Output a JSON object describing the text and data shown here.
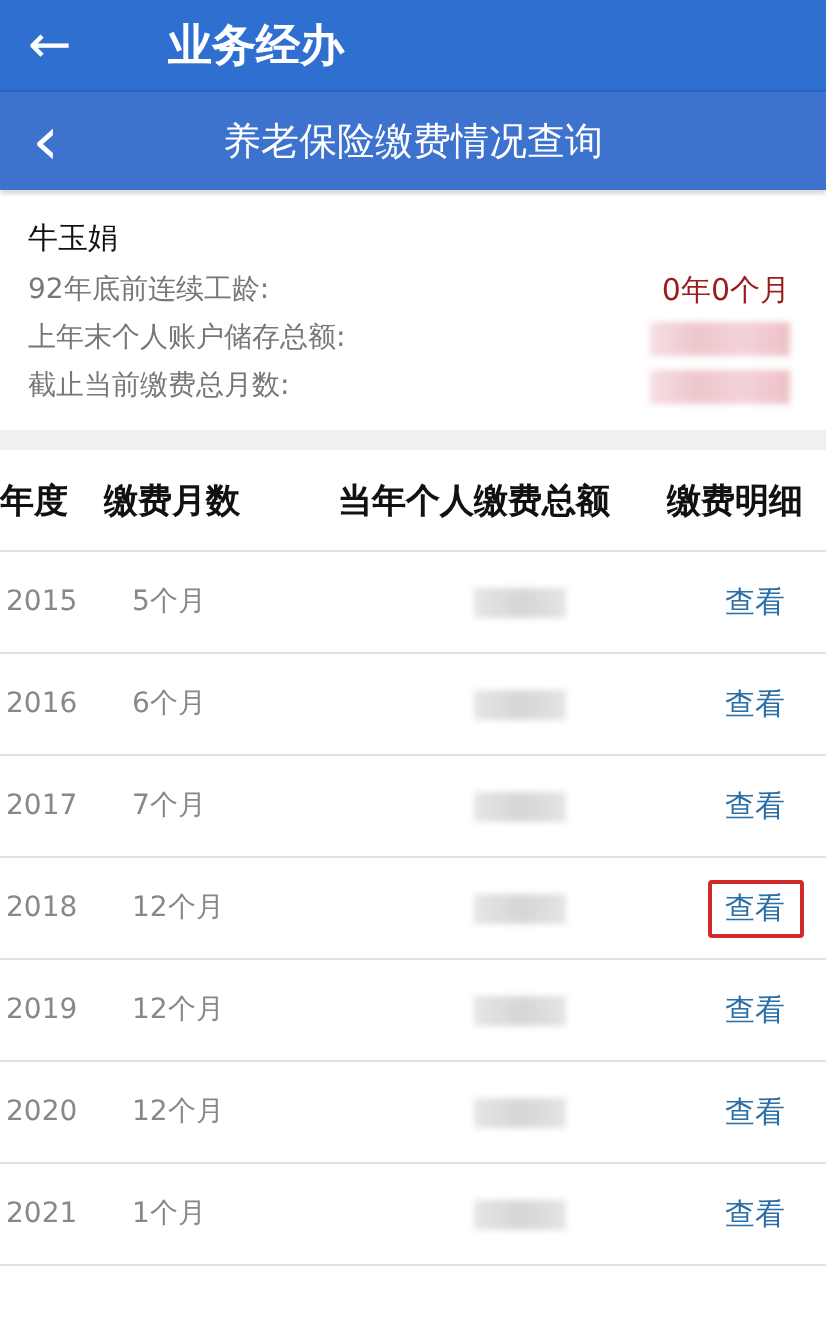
{
  "app_bar": {
    "back_icon": "←",
    "title": "业务经办"
  },
  "sub_bar": {
    "back_icon": "‹",
    "title": "养老保险缴费情况查询"
  },
  "info": {
    "name": "牛玉娟",
    "fields": [
      {
        "label": "92年底前连续工龄:",
        "value": "0年0个月",
        "redacted": false
      },
      {
        "label": "上年末个人账户储存总额:",
        "redacted": true
      },
      {
        "label": "截止当前缴费总月数:",
        "redacted": true
      }
    ]
  },
  "table": {
    "columns": [
      "年度",
      "缴费月数",
      "当年个人缴费总额",
      "缴费明细"
    ],
    "rows": [
      {
        "year": "2015",
        "months": "5个月",
        "amount_redacted": true,
        "link": "查看",
        "highlighted": false
      },
      {
        "year": "2016",
        "months": "6个月",
        "amount_redacted": true,
        "link": "查看",
        "highlighted": false
      },
      {
        "year": "2017",
        "months": "7个月",
        "amount_redacted": true,
        "link": "查看",
        "highlighted": false
      },
      {
        "year": "2018",
        "months": "12个月",
        "amount_redacted": true,
        "link": "查看",
        "highlighted": true
      },
      {
        "year": "2019",
        "months": "12个月",
        "amount_redacted": true,
        "link": "查看",
        "highlighted": false
      },
      {
        "year": "2020",
        "months": "12个月",
        "amount_redacted": true,
        "link": "查看",
        "highlighted": false
      },
      {
        "year": "2021",
        "months": "1个月",
        "amount_redacted": true,
        "link": "查看",
        "highlighted": false
      }
    ]
  }
}
